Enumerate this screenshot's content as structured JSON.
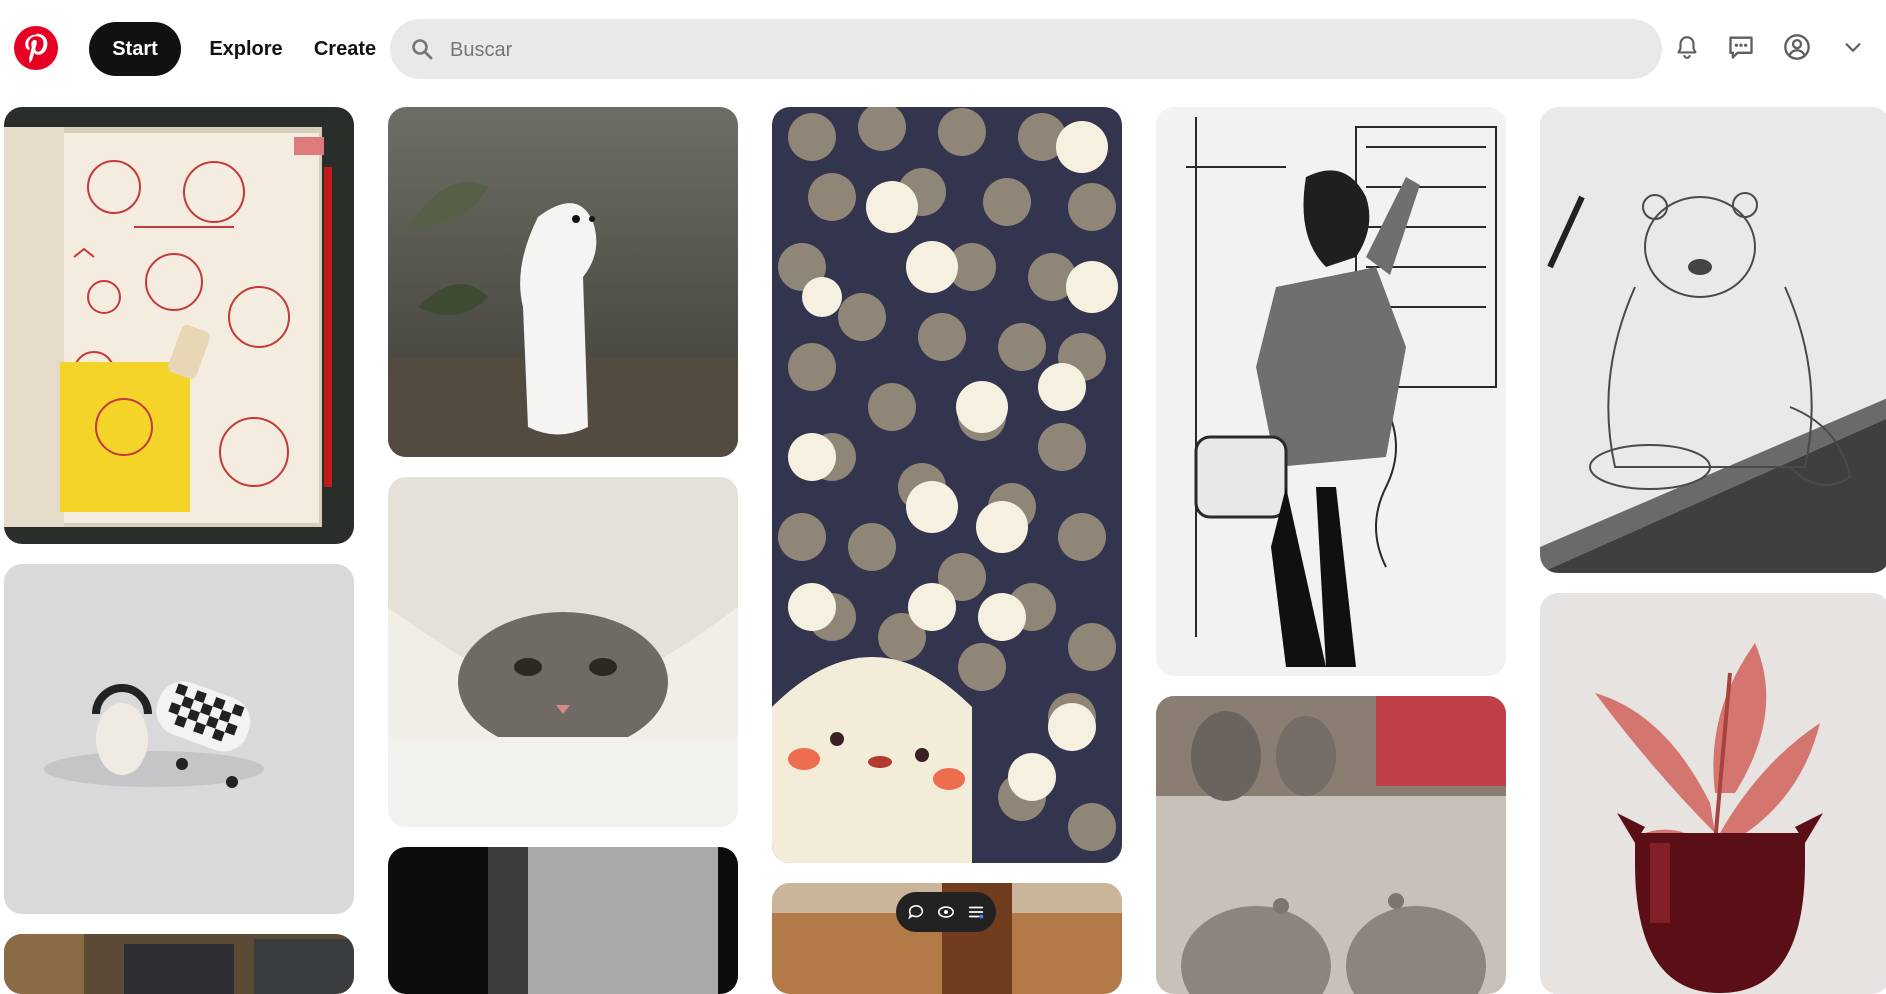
{
  "header": {
    "logo_name": "pinterest-logo",
    "nav": {
      "start": "Start",
      "explore": "Explore",
      "create": "Create"
    },
    "search": {
      "placeholder": "Buscar",
      "value": ""
    },
    "icons": [
      "bell-icon",
      "messages-icon",
      "profile-icon",
      "chevron-down-icon"
    ]
  },
  "colors": {
    "brand": "#e60023",
    "active_nav": "#111111",
    "search_bg": "#e9e9e9"
  },
  "pins": [
    {
      "name": "pin-cat-sketchbook"
    },
    {
      "name": "pin-wooden-ermine"
    },
    {
      "name": "pin-ghost-crowd"
    },
    {
      "name": "pin-manga-commuter"
    },
    {
      "name": "pin-bear-pencil-sketch"
    },
    {
      "name": "pin-ceramic-cat-skateboard"
    },
    {
      "name": "pin-cat-under-blanket"
    },
    {
      "name": "pin-clay-figures"
    },
    {
      "name": "pin-devil-planter"
    },
    {
      "name": "pin-desk-partial"
    },
    {
      "name": "pin-dark-room-partial"
    },
    {
      "name": "pin-wood-partial"
    }
  ],
  "pin_overlay": {
    "icons": [
      "comment-icon",
      "view-icon",
      "list-icon"
    ]
  }
}
